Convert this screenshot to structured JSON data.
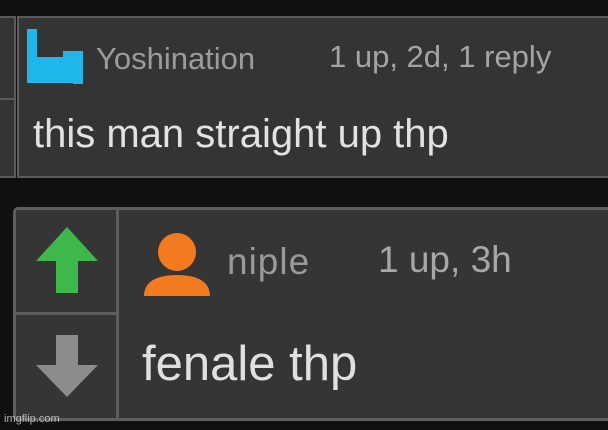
{
  "comment_1": {
    "username": "Yoshination",
    "meta": "1 up, 2d, 1 reply",
    "text": "this man straight up thp",
    "avatar_color": "#1fb6ec",
    "avatar_icon": "blue-bracket-avatar-icon"
  },
  "comment_2": {
    "username": "niple",
    "meta": "1 up, 3h",
    "text": "fenale thp",
    "avatar_color": "#f47a20",
    "avatar_icon": "user-silhouette-icon",
    "upvote_icon": "upvote-arrow-icon",
    "upvote_color": "#3eb84a",
    "downvote_icon": "downvote-arrow-icon",
    "downvote_color": "#8c8c8c"
  },
  "watermark": "imgflip.com"
}
